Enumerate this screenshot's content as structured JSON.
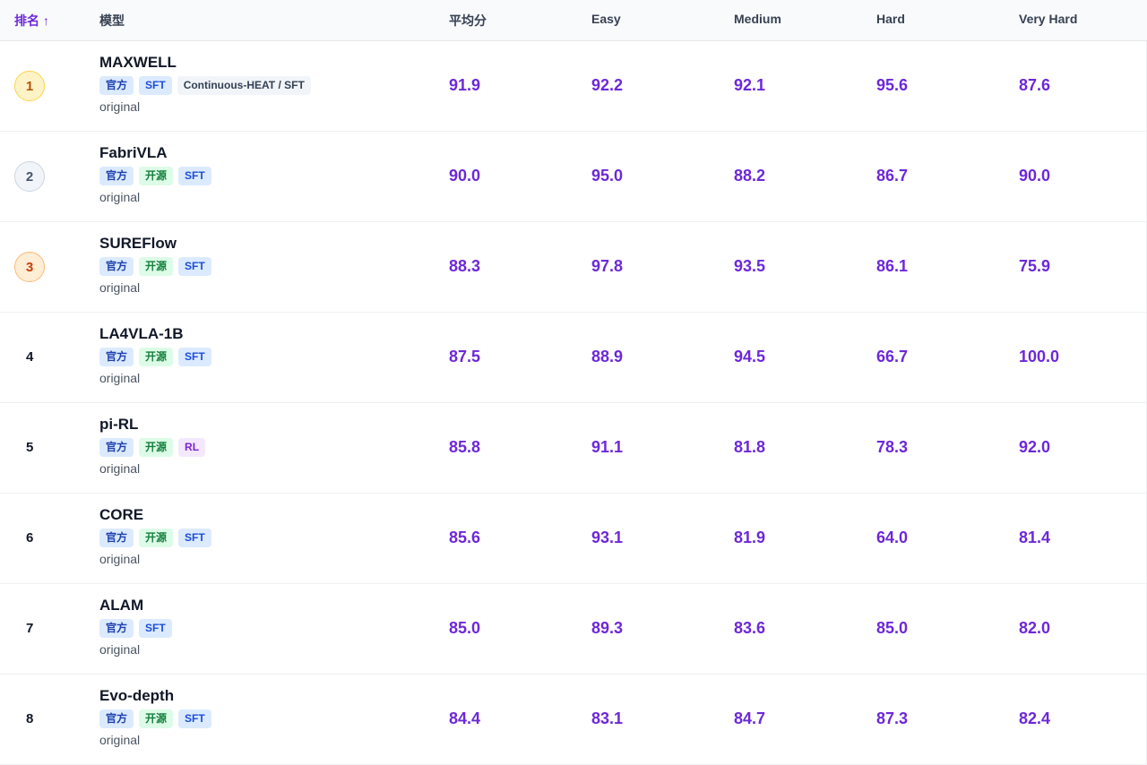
{
  "header": {
    "rank": "排名 ↑",
    "model": "模型",
    "avg": "平均分",
    "easy": "Easy",
    "medium": "Medium",
    "hard": "Hard",
    "very_hard": "Very Hard"
  },
  "rows": [
    {
      "rank": "1",
      "name": "MAXWELL",
      "tags": [
        "官方",
        "SFT",
        "Continuous-HEAT / SFT"
      ],
      "variant": "original",
      "avg": "91.9",
      "easy": "92.2",
      "medium": "92.1",
      "hard": "95.6",
      "very_hard": "87.6"
    },
    {
      "rank": "2",
      "name": "FabriVLA",
      "tags": [
        "官方",
        "开源",
        "SFT"
      ],
      "variant": "original",
      "avg": "90.0",
      "easy": "95.0",
      "medium": "88.2",
      "hard": "86.7",
      "very_hard": "90.0"
    },
    {
      "rank": "3",
      "name": "SUREFlow",
      "tags": [
        "官方",
        "开源",
        "SFT"
      ],
      "variant": "original",
      "avg": "88.3",
      "easy": "97.8",
      "medium": "93.5",
      "hard": "86.1",
      "very_hard": "75.9"
    },
    {
      "rank": "4",
      "name": "LA4VLA-1B",
      "tags": [
        "官方",
        "开源",
        "SFT"
      ],
      "variant": "original",
      "avg": "87.5",
      "easy": "88.9",
      "medium": "94.5",
      "hard": "66.7",
      "very_hard": "100.0"
    },
    {
      "rank": "5",
      "name": "pi-RL",
      "tags": [
        "官方",
        "开源",
        "RL"
      ],
      "variant": "original",
      "avg": "85.8",
      "easy": "91.1",
      "medium": "81.8",
      "hard": "78.3",
      "very_hard": "92.0"
    },
    {
      "rank": "6",
      "name": "CORE",
      "tags": [
        "官方",
        "开源",
        "SFT"
      ],
      "variant": "original",
      "avg": "85.6",
      "easy": "93.1",
      "medium": "81.9",
      "hard": "64.0",
      "very_hard": "81.4"
    },
    {
      "rank": "7",
      "name": "ALAM",
      "tags": [
        "官方",
        "SFT"
      ],
      "variant": "original",
      "avg": "85.0",
      "easy": "89.3",
      "medium": "83.6",
      "hard": "85.0",
      "very_hard": "82.0"
    },
    {
      "rank": "8",
      "name": "Evo-depth",
      "tags": [
        "官方",
        "开源",
        "SFT"
      ],
      "variant": "original",
      "avg": "84.4",
      "easy": "83.1",
      "medium": "84.7",
      "hard": "87.3",
      "very_hard": "82.4"
    }
  ],
  "colors": {
    "score": "#6d28d9",
    "rank1_bg": "#fef3c7",
    "rank1_fg": "#b45309",
    "rank1_border": "#fcd34d",
    "rank2_bg": "#f1f5f9",
    "rank2_fg": "#475569",
    "rank2_border": "#cbd5e1",
    "rank3_bg": "#ffedd5",
    "rank3_fg": "#c2410c",
    "rank3_border": "#fdba74"
  }
}
